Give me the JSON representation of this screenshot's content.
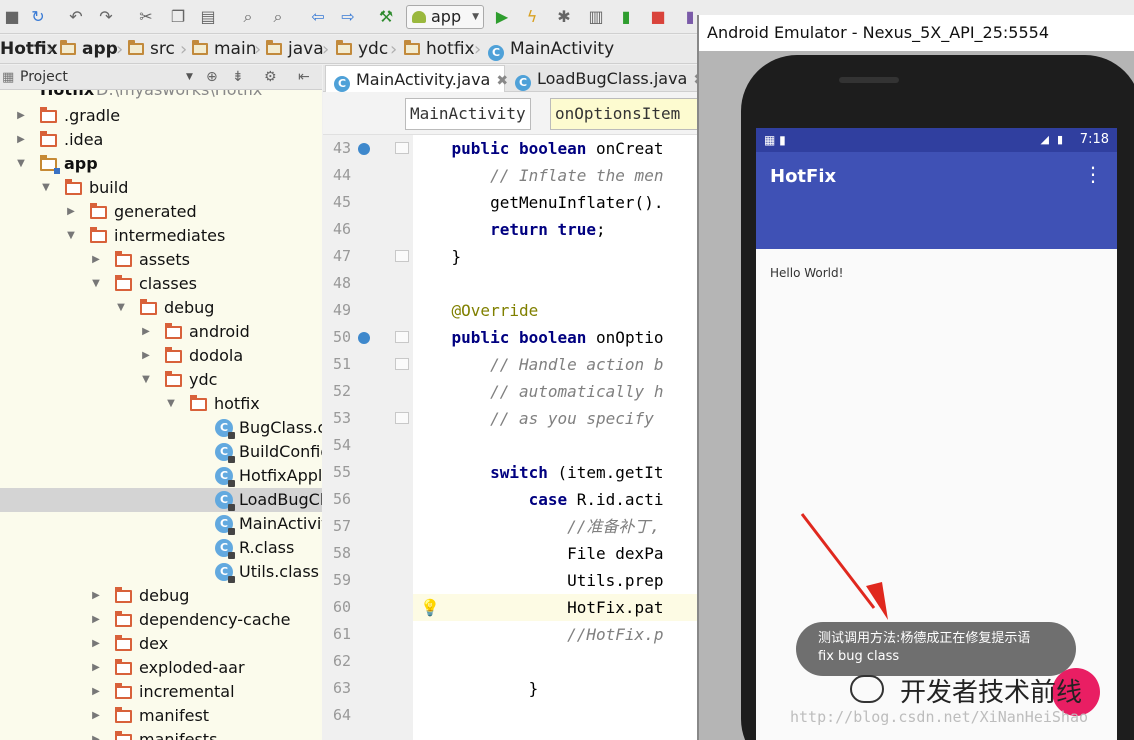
{
  "toolbar": {
    "config_select": "app",
    "icons": [
      "save-icon",
      "sync-icon",
      "undo-icon",
      "redo-icon",
      "cut-icon",
      "copy-icon",
      "paste-icon",
      "find-icon",
      "replace-icon",
      "back-icon",
      "forward-icon",
      "build-icon",
      "run-icon",
      "apply-changes-icon",
      "debug-icon",
      "profile-icon",
      "attach-icon",
      "stop-icon"
    ]
  },
  "breadcrumb": [
    "Hotfix",
    "app",
    "src",
    "main",
    "java",
    "ydc",
    "hotfix",
    "MainActivity"
  ],
  "project": {
    "header": "Project",
    "root": "Hotfix",
    "root_path": "D:\\myasworks\\Hotfix",
    "items": [
      {
        "label": ".gradle"
      },
      {
        "label": ".idea"
      },
      {
        "label": "app"
      },
      {
        "label": "build"
      },
      {
        "label": "generated"
      },
      {
        "label": "intermediates"
      },
      {
        "label": "assets"
      },
      {
        "label": "classes"
      },
      {
        "label": "debug"
      },
      {
        "label": "android"
      },
      {
        "label": "dodola"
      },
      {
        "label": "ydc"
      },
      {
        "label": "hotfix"
      },
      {
        "label": "BugClass.cla"
      },
      {
        "label": "BuildConfig"
      },
      {
        "label": "HotfixAppli"
      },
      {
        "label": "LoadBugCla"
      },
      {
        "label": "MainActivit"
      },
      {
        "label": "R.class"
      },
      {
        "label": "Utils.class"
      },
      {
        "label": "debug"
      },
      {
        "label": "dependency-cache"
      },
      {
        "label": "dex"
      },
      {
        "label": "exploded-aar"
      },
      {
        "label": "incremental"
      },
      {
        "label": "manifest"
      },
      {
        "label": "manifests"
      }
    ]
  },
  "tabs": [
    {
      "label": "MainActivity.java"
    },
    {
      "label": "LoadBugClass.java"
    }
  ],
  "editor": {
    "nav_class": "MainActivity",
    "nav_method": "onOptionsItem",
    "lines": [
      {
        "n": "43",
        "text": "    public boolean onCreat"
      },
      {
        "n": "44",
        "text": "        // Inflate the men"
      },
      {
        "n": "45",
        "text": "        getMenuInflater()."
      },
      {
        "n": "46",
        "text": "        return true;"
      },
      {
        "n": "47",
        "text": "    }"
      },
      {
        "n": "48",
        "text": ""
      },
      {
        "n": "49",
        "text": "    @Override"
      },
      {
        "n": "50",
        "text": "    public boolean onOptio"
      },
      {
        "n": "51",
        "text": "        // Handle action b"
      },
      {
        "n": "52",
        "text": "        // automatically h"
      },
      {
        "n": "53",
        "text": "        // as you specify"
      },
      {
        "n": "54",
        "text": ""
      },
      {
        "n": "55",
        "text": "        switch (item.getIt"
      },
      {
        "n": "56",
        "text": "            case R.id.acti"
      },
      {
        "n": "57",
        "text": "                //准备补丁,"
      },
      {
        "n": "58",
        "text": "                File dexPa"
      },
      {
        "n": "59",
        "text": "                Utils.prep"
      },
      {
        "n": "60",
        "text": "                HotFix.pat"
      },
      {
        "n": "61",
        "text": "                //HotFix.p"
      },
      {
        "n": "62",
        "text": ""
      },
      {
        "n": "63",
        "text": "            }"
      },
      {
        "n": "64",
        "text": ""
      }
    ]
  },
  "emulator": {
    "title": "Android Emulator - Nexus_5X_API_25:5554",
    "time": "7:18",
    "app_title": "HotFix",
    "hello": "Hello World!",
    "toast_line1": "测试调用方法:杨德成正在修复提示语",
    "toast_line2": "fix bug class"
  },
  "watermark": {
    "text": "开发者技术前线",
    "url": "http://blog.csdn.net/XiNanHeiShao"
  }
}
